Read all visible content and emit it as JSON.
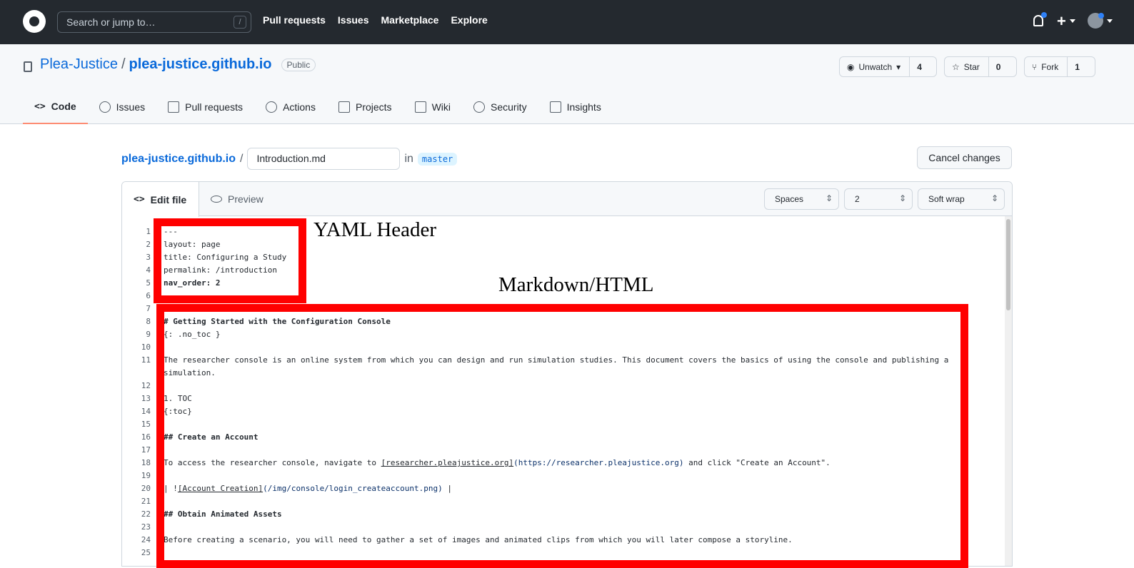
{
  "topbar": {
    "search_placeholder": "Search or jump to…",
    "search_shortcut": "/",
    "nav": [
      "Pull requests",
      "Issues",
      "Marketplace",
      "Explore"
    ],
    "plus_label": "+"
  },
  "repo": {
    "owner": "Plea-Justice",
    "separator": "/",
    "name": "plea-justice.github.io",
    "visibility": "Public",
    "unwatch_label": "Unwatch",
    "watch_count": "4",
    "star_label": "Star",
    "star_count": "0",
    "fork_label": "Fork",
    "fork_count": "1"
  },
  "tabs": [
    {
      "label": "Code",
      "icon": "code-icon",
      "active": true
    },
    {
      "label": "Issues",
      "icon": "issue-icon"
    },
    {
      "label": "Pull requests",
      "icon": "pull-request-icon"
    },
    {
      "label": "Actions",
      "icon": "play-icon"
    },
    {
      "label": "Projects",
      "icon": "project-icon"
    },
    {
      "label": "Wiki",
      "icon": "book-icon"
    },
    {
      "label": "Security",
      "icon": "shield-icon"
    },
    {
      "label": "Insights",
      "icon": "graph-icon"
    }
  ],
  "editor_header": {
    "repo_link": "plea-justice.github.io",
    "separator": "/",
    "filename": "Introduction.md",
    "in_label": "in",
    "branch": "master",
    "cancel_label": "Cancel changes"
  },
  "editor": {
    "edit_tab": "Edit file",
    "preview_tab": "Preview",
    "indent_mode": "Spaces",
    "indent_size": "2",
    "wrap_mode": "Soft wrap",
    "line_numbers": [
      "1",
      "2",
      "3",
      "4",
      "5",
      "6",
      "7",
      "8",
      "9",
      "10",
      "11",
      "12",
      "13",
      "14",
      "15",
      "16",
      "17",
      "18",
      "19",
      "20",
      "21",
      "22",
      "23",
      "24",
      "25"
    ],
    "lines": {
      "l1": "---",
      "l2": "layout: page",
      "l3": "title: Configuring a Study",
      "l4": "permalink: /introduction",
      "l5": "nav_order: 2",
      "l6": "---",
      "l7": "",
      "l8": "# Getting Started with the Configuration Console",
      "l9": "{: .no_toc }",
      "l10": "",
      "l11": "The researcher console is an online system from which you can design and run simulation studies. This document covers the basics of using the console and publishing a simulation.",
      "l12": "",
      "l13": "1. TOC",
      "l14": "{:toc}",
      "l15": "",
      "l16": "## Create an Account",
      "l17": "",
      "l18_a": "To access the researcher console, navigate to ",
      "l18_link": "[researcher.pleajustice.org]",
      "l18_url": "(https://researcher.pleajustice.org)",
      "l18_b": " and click \"Create an Account\".",
      "l19": "",
      "l20_a": "| !",
      "l20_link": "[Account Creation]",
      "l20_url": "(/img/console/login_createaccount.png)",
      "l20_b": " |",
      "l21": "",
      "l22": "## Obtain Animated Assets",
      "l23": "",
      "l24": "Before creating a scenario, you will need to gather a set of images and animated clips from which you will later compose a storyline.",
      "l25": ""
    }
  },
  "annotations": {
    "yaml_label": "YAML Header",
    "markdown_label": "Markdown/HTML",
    "box_color": "#ff0000"
  }
}
